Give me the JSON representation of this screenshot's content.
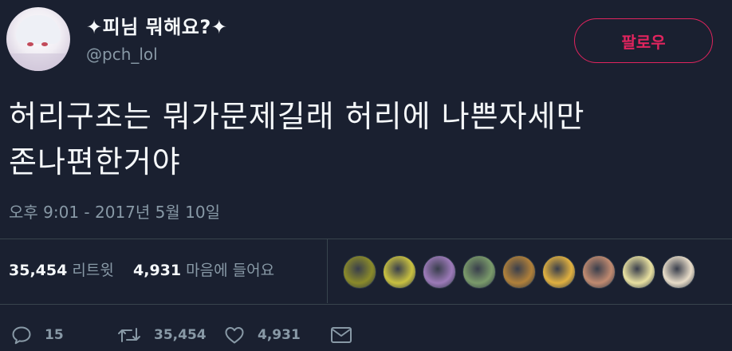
{
  "tweet": {
    "display_name": "✦피님 뭐해요?✦",
    "handle": "@pch_lol",
    "follow_label": "팔로우",
    "text_line1": "허리구조는 뭐가문제길래 허리에 나쁜자세만",
    "text_line2": "존나편한거야",
    "timestamp": "오후 9:01 - 2017년 5월 10일"
  },
  "stats": {
    "retweets_count": "35,454",
    "retweets_label": "리트윗",
    "likes_count": "4,931",
    "likes_label": "마음에 들어요"
  },
  "likers": [
    {
      "name": "liker-avatar",
      "color": "#8a8a2a"
    },
    {
      "name": "liker-avatar",
      "color": "#c8c040"
    },
    {
      "name": "liker-avatar",
      "color": "#9c7ab8"
    },
    {
      "name": "liker-avatar",
      "color": "#7a9a6a"
    },
    {
      "name": "liker-avatar",
      "color": "#b0803a"
    },
    {
      "name": "liker-avatar",
      "color": "#e0b040"
    },
    {
      "name": "liker-avatar",
      "color": "#c08a70"
    },
    {
      "name": "liker-avatar",
      "color": "#e8e0a0"
    },
    {
      "name": "liker-avatar",
      "color": "#e8dcc8"
    }
  ],
  "actions": {
    "reply_icon": "reply-icon",
    "reply_count": "15",
    "retweet_icon": "retweet-icon",
    "retweet_count": "35,454",
    "like_icon": "heart-icon",
    "like_count": "4,931",
    "message_icon": "envelope-icon"
  },
  "colors": {
    "background": "#1a2030",
    "accent": "#e0245e",
    "muted": "#8899a6",
    "divider": "#38444d"
  }
}
